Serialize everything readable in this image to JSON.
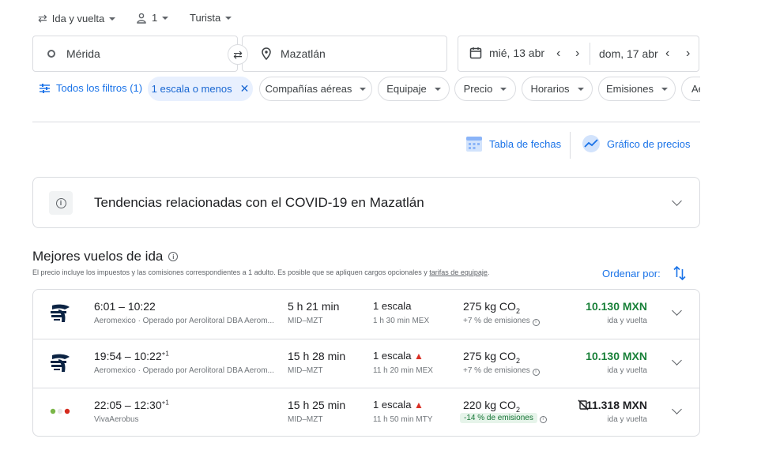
{
  "search": {
    "trip_type": "Ida y vuelta",
    "passengers": "1",
    "cabin": "Turista",
    "origin": "Mérida",
    "destination": "Mazatlán",
    "depart_date": "mié, 13 abr",
    "return_date": "dom, 17 abr"
  },
  "filters": {
    "all_filters": "Todos los filtros (1)",
    "active_chip": "1 escala o menos",
    "chips": [
      "Compañías aéreas",
      "Equipaje",
      "Precio",
      "Horarios",
      "Emisiones",
      "Ae"
    ]
  },
  "views": {
    "date_table": "Tabla de fechas",
    "price_graph": "Gráfico de precios"
  },
  "covid": {
    "text": "Tendencias relacionadas con el COVID-19 en Mazatlán"
  },
  "results": {
    "title": "Mejores vuelos de ida",
    "disclaimer_text": "El precio incluye los impuestos y las comisiones correspondientes a 1 adulto. Es posible que se apliquen cargos opcionales y ",
    "disclaimer_link": "tarifas de equipaje",
    "disclaimer_end": ".",
    "sort_label": "Ordenar por:"
  },
  "flights": [
    {
      "times": "6:01 – 10:22",
      "plus_day": "",
      "airline": "Aeromexico · Operado por Aerolitoral DBA Aerom...",
      "duration": "5 h 21 min",
      "route": "MID–MZT",
      "stops": "1 escala",
      "stop_detail": "1 h 30 min MEX",
      "warning": false,
      "co2_value": "275 kg CO",
      "co2_sub": "2",
      "emissions": "+7 % de emisiones",
      "emissions_good": false,
      "price": "10.130 MXN",
      "price_sub": "ida y vuelta",
      "price_color": "#188038"
    },
    {
      "times": "19:54 – 10:22",
      "plus_day": "+1",
      "airline": "Aeromexico · Operado por Aerolitoral DBA Aerom...",
      "duration": "15 h 28 min",
      "route": "MID–MZT",
      "stops": "1 escala",
      "stop_detail": "11 h 20 min MEX",
      "warning": true,
      "co2_value": "275 kg CO",
      "co2_sub": "2",
      "emissions": "+7 % de emisiones",
      "emissions_good": false,
      "price": "10.130 MXN",
      "price_sub": "ida y vuelta",
      "price_color": "#188038"
    },
    {
      "times": "22:05 – 12:30",
      "plus_day": "+1",
      "airline": "VivaAerobus",
      "duration": "15 h 25 min",
      "route": "MID–MZT",
      "stops": "1 escala",
      "stop_detail": "11 h 50 min MTY",
      "warning": true,
      "co2_value": "220 kg CO",
      "co2_sub": "2",
      "emissions": "-14 % de emisiones",
      "emissions_good": true,
      "price": "11.318 MXN",
      "price_sub": "ida y vuelta",
      "price_color": "#202124"
    }
  ]
}
